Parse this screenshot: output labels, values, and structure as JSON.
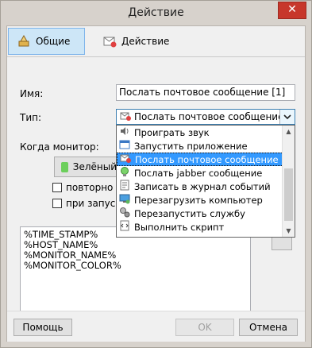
{
  "window": {
    "title": "Действие",
    "close_glyph": "✕"
  },
  "tabs": [
    {
      "label": "Общие",
      "icon": "gear-tools-icon"
    },
    {
      "label": "Действие",
      "icon": "mail-icon"
    }
  ],
  "form": {
    "name_label": "Имя:",
    "name_value": "Послать почтовое сообщение [1]",
    "type_label": "Тип:",
    "type_value": "Послать почтовое сообщение",
    "when_label": "Когда монитор:",
    "status_button": "Зелёный",
    "repeat_label": "повторно",
    "on_start_label": "при запуске"
  },
  "dropdown": {
    "items": [
      {
        "label": "Проиграть звук",
        "icon": "speaker-icon"
      },
      {
        "label": "Запустить приложение",
        "icon": "app-window-icon"
      },
      {
        "label": "Послать почтовое сообщение",
        "icon": "mail-icon",
        "selected": true
      },
      {
        "label": "Послать jabber сообщение",
        "icon": "jabber-bulb-icon"
      },
      {
        "label": "Записать в журнал событий",
        "icon": "log-icon"
      },
      {
        "label": "Перезагрузить компьютер",
        "icon": "computer-icon"
      },
      {
        "label": "Перезапустить службу",
        "icon": "gears-icon"
      },
      {
        "label": "Выполнить скрипт",
        "icon": "script-icon"
      }
    ]
  },
  "memo": {
    "lines": [
      "%TIME_STAMP%",
      "%HOST_NAME%",
      "%MONITOR_NAME%",
      "%MONITOR_COLOR%"
    ]
  },
  "buttons": {
    "help": "Помощь",
    "ok": "OK",
    "cancel": "Отмена"
  },
  "colors": {
    "accent": "#3399ff",
    "status_green": "#6ccf5c",
    "close_red": "#c7372b"
  }
}
